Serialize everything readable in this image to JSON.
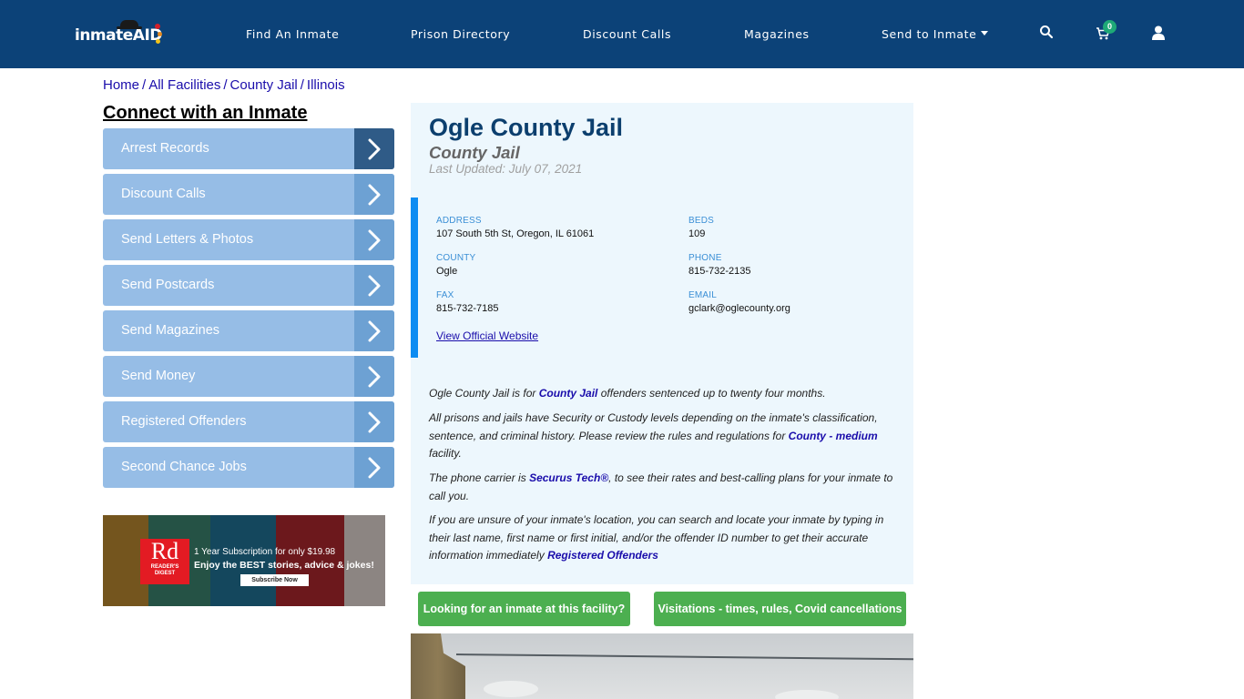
{
  "header": {
    "logo": {
      "text": "inmate",
      "accent_text": "AID"
    },
    "nav": [
      {
        "label": "Find An Inmate"
      },
      {
        "label": "Prison Directory"
      },
      {
        "label": "Discount Calls"
      },
      {
        "label": "Magazines"
      },
      {
        "label": "Send to Inmate",
        "has_dropdown": true
      }
    ],
    "icons": {
      "search": "search-icon",
      "cart": "cart-icon",
      "user": "user-icon"
    },
    "cart_count": "0",
    "colors": {
      "background": "#0c4278",
      "badge": "#1ea977"
    }
  },
  "breadcrumb": [
    {
      "label": "Home"
    },
    {
      "label": "All Facilities"
    },
    {
      "label": "County Jail"
    },
    {
      "label": "Illinois"
    }
  ],
  "sidebar": {
    "title": "Connect with an Inmate",
    "items": [
      {
        "label": "Arrest Records",
        "active": true
      },
      {
        "label": "Discount Calls"
      },
      {
        "label": "Send Letters & Photos"
      },
      {
        "label": "Send Postcards"
      },
      {
        "label": "Send Magazines"
      },
      {
        "label": "Send Money"
      },
      {
        "label": "Registered Offenders"
      },
      {
        "label": "Second Chance Jobs"
      }
    ],
    "ad": {
      "brand_big": "Rd",
      "brand_small_1": "READER'S",
      "brand_small_2": "DIGEST",
      "line1": "1 Year Subscription for only $19.98",
      "line2": "Enjoy the BEST stories, advice & jokes!",
      "button": "Subscribe Now"
    }
  },
  "facility": {
    "name": "Ogle County Jail",
    "type": "County Jail",
    "last_updated": "Last Updated: July 07, 2021",
    "info": {
      "address": {
        "label": "ADDRESS",
        "value": "107 South 5th St, Oregon, IL 61061"
      },
      "beds": {
        "label": "BEDS",
        "value": "109"
      },
      "county": {
        "label": "COUNTY",
        "value": "Ogle"
      },
      "phone": {
        "label": "PHONE",
        "value": "815-732-2135"
      },
      "fax": {
        "label": "FAX",
        "value": "815-732-7185"
      },
      "email": {
        "label": "EMAIL",
        "value": "gclark@oglecounty.org"
      }
    },
    "official_website_link": "View Official Website",
    "description": {
      "p1": {
        "before": "Ogle County Jail is for ",
        "link": "County Jail",
        "after": " offenders sentenced up to twenty four months."
      },
      "p2": {
        "before": "All prisons and jails have Security or Custody levels depending on the inmate's classification, sentence, and criminal history. Please review the rules and regulations for ",
        "link": "County - medium",
        "after": " facility."
      },
      "p3": {
        "before": "The phone carrier is ",
        "link": "Securus Tech®",
        "after": ", to see their rates and best-calling plans for your inmate to call you."
      },
      "p4": {
        "before": "If you are unsure of your inmate's location, you can search and locate your inmate by typing in their last name, first name or first initial, and/or the offender ID number to get their accurate information immediately ",
        "link": "Registered Offenders",
        "after": ""
      }
    },
    "buttons": {
      "find_inmate": "Looking for an inmate at this facility?",
      "visitations": "Visitations - times, rules, Covid cancellations"
    }
  }
}
